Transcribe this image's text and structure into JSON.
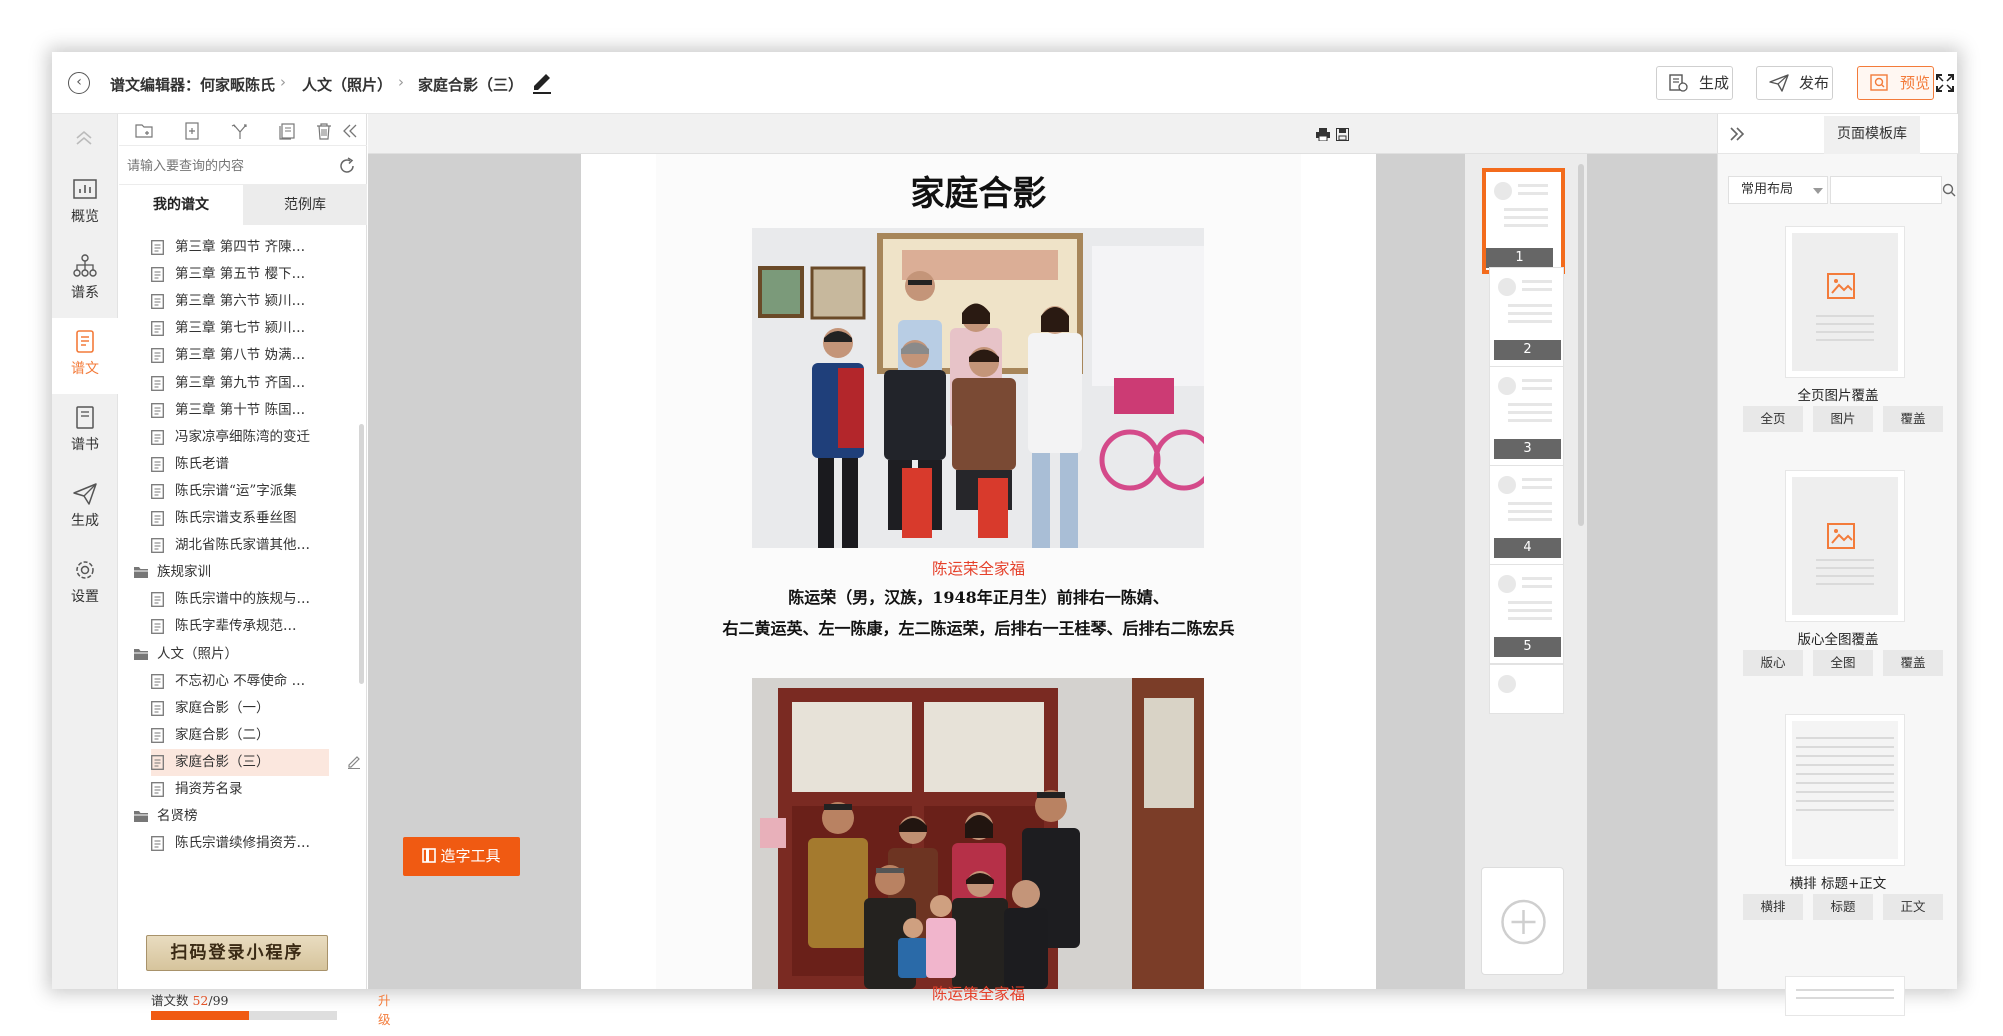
{
  "header": {
    "crumbs": [
      "谱文编辑器：何家畈陈氏",
      "人文（照片）",
      "家庭合影（三）"
    ],
    "buttons": {
      "generate": "生成",
      "publish": "发布",
      "preview": "预览"
    }
  },
  "leftnav": {
    "items": [
      {
        "label": "概览",
        "icon": "chart-icon"
      },
      {
        "label": "谱系",
        "icon": "tree-icon"
      },
      {
        "label": "谱文",
        "icon": "document-icon",
        "active": true
      },
      {
        "label": "谱书",
        "icon": "book-icon"
      },
      {
        "label": "生成",
        "icon": "send-icon"
      },
      {
        "label": "设置",
        "icon": "gear-icon"
      }
    ]
  },
  "tree": {
    "search_placeholder": "请输入要查询的内容",
    "tabs": {
      "mine": "我的谱文",
      "examples": "范例库"
    },
    "rows": [
      {
        "type": "doc",
        "label": "第三章 第四节 齐陳…",
        "indent": 1
      },
      {
        "type": "doc",
        "label": "第三章 第五节 樱下…",
        "indent": 1
      },
      {
        "type": "doc",
        "label": "第三章 第六节 颍川…",
        "indent": 1
      },
      {
        "type": "doc",
        "label": "第三章 第七节 颍川…",
        "indent": 1
      },
      {
        "type": "doc",
        "label": "第三章 第八节 妫满…",
        "indent": 1
      },
      {
        "type": "doc",
        "label": "第三章 第九节 齐国…",
        "indent": 1
      },
      {
        "type": "doc",
        "label": "第三章 第十节 陈国…",
        "indent": 1
      },
      {
        "type": "doc",
        "label": "冯家凉亭细陈湾的变迁",
        "indent": 1
      },
      {
        "type": "doc",
        "label": "陈氏老谱",
        "indent": 1
      },
      {
        "type": "doc",
        "label": "陈氏宗谱“运”字派集",
        "indent": 1
      },
      {
        "type": "doc",
        "label": "陈氏宗谱支系垂丝图",
        "indent": 1
      },
      {
        "type": "doc",
        "label": "湖北省陈氏家谱其他…",
        "indent": 1
      },
      {
        "type": "folder",
        "label": "族规家训",
        "indent": 0
      },
      {
        "type": "doc",
        "label": "陈氏宗谱中的族规与…",
        "indent": 1
      },
      {
        "type": "doc",
        "label": "陈氏字辈传承规范…",
        "indent": 1
      },
      {
        "type": "folder",
        "label": "人文（照片）",
        "indent": 0
      },
      {
        "type": "doc",
        "label": "不忘初心 不辱使命 …",
        "indent": 1
      },
      {
        "type": "doc",
        "label": "家庭合影（一）",
        "indent": 1
      },
      {
        "type": "doc",
        "label": "家庭合影（二）",
        "indent": 1
      },
      {
        "type": "doc",
        "label": "家庭合影（三）",
        "indent": 1,
        "selected": true
      },
      {
        "type": "doc",
        "label": "捐资芳名录",
        "indent": 1
      },
      {
        "type": "folder",
        "label": "名贤榜",
        "indent": 0
      },
      {
        "type": "doc",
        "label": "陈氏宗谱续修捐资芳…",
        "indent": 1
      }
    ],
    "qr_banner": "扫码登录小程序",
    "count_label": "谱文数 ",
    "count_used": "52",
    "count_total": "/99",
    "count_fraction": 0.525,
    "upgrade": "升级"
  },
  "document": {
    "title": "家庭合影",
    "caption1": "陈运荣全家福",
    "desc1": "陈运荣（男，汉族，1948年正月生）前排右一陈婧、",
    "desc2": "右二黄运英、左一陈康，左二陈运荣，后排右一王桂琴、后排右二陈宏兵",
    "caption2": "陈运策全家福"
  },
  "tool_button": "造字工具",
  "thumbnails": [
    "1",
    "2",
    "3",
    "4",
    "5"
  ],
  "rightpanel": {
    "title": "页面模板库",
    "layout_select": "常用布局",
    "templates": [
      {
        "name": "全页图片覆盖",
        "buttons": [
          "全页",
          "图片",
          "覆盖"
        ]
      },
      {
        "name": "版心全图覆盖",
        "buttons": [
          "版心",
          "全图",
          "覆盖"
        ]
      },
      {
        "name": "横排 标题+正文",
        "buttons": [
          "横排",
          "标题",
          "正文"
        ]
      }
    ]
  }
}
